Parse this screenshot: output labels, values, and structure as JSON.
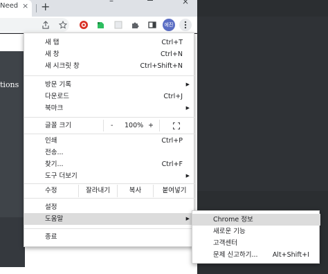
{
  "browser": {
    "tab_title": "Need",
    "tab_close": "×",
    "new_tab": "+",
    "window_min": "–",
    "window_close": "×",
    "profile_badge": "에진"
  },
  "page": {
    "hero_text": "tions"
  },
  "menu": {
    "new_tab": {
      "label": "새 탭",
      "shortcut": "Ctrl+T"
    },
    "new_window": {
      "label": "새 창",
      "shortcut": "Ctrl+N"
    },
    "new_incognito": {
      "label": "새 시크릿 창",
      "shortcut": "Ctrl+Shift+N"
    },
    "history": {
      "label": "방문 기록"
    },
    "downloads": {
      "label": "다운로드",
      "shortcut": "Ctrl+J"
    },
    "bookmarks": {
      "label": "북마크"
    },
    "zoom": {
      "label": "글꼴 크기",
      "minus": "-",
      "value": "100%",
      "plus": "+"
    },
    "print": {
      "label": "인쇄",
      "shortcut": "Ctrl+P"
    },
    "cast": {
      "label": "전송..."
    },
    "find": {
      "label": "찾기...",
      "shortcut": "Ctrl+F"
    },
    "more_tools": {
      "label": "도구 더보기"
    },
    "edit": {
      "label": "수정",
      "cut": "잘라내기",
      "copy": "복사",
      "paste": "붙여넣기"
    },
    "settings": {
      "label": "설정"
    },
    "help": {
      "label": "도움말"
    },
    "exit": {
      "label": "종료"
    }
  },
  "submenu": {
    "about": {
      "label": "Chrome 정보"
    },
    "whats_new": {
      "label": "새로운 기능"
    },
    "help_center": {
      "label": "고객센터"
    },
    "report": {
      "label": "문제 신고하기...",
      "shortcut": "Alt+Shift+I"
    }
  }
}
